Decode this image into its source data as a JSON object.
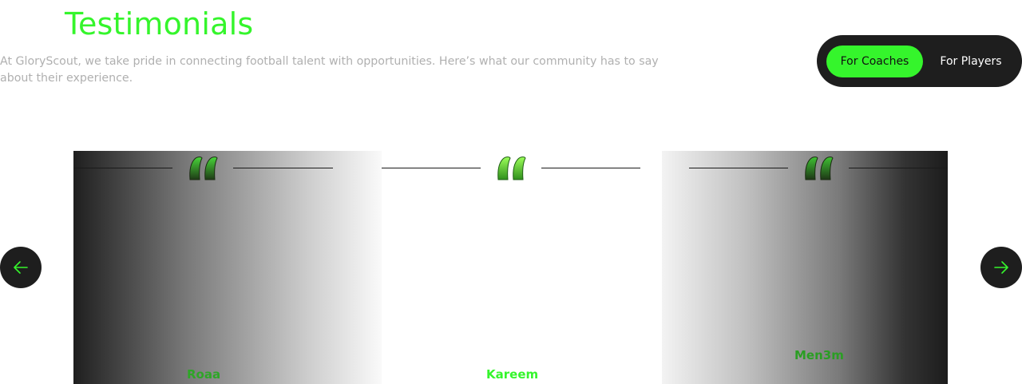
{
  "header": {
    "title": "Testimonials",
    "intro": "At GloryScout, we take pride in connecting football talent with opportunities. Here’s what our community has to say about their experience."
  },
  "audience_toggle": {
    "options": [
      "For Coaches",
      "For Players"
    ],
    "selected": "For Coaches"
  },
  "testimonials": [
    {
      "author": "Roaa"
    },
    {
      "author": "Kareem"
    },
    {
      "author": "Men3m"
    }
  ],
  "carousel": {
    "prev_icon": "arrow-left-icon",
    "next_icon": "arrow-right-icon"
  },
  "colors": {
    "accent": "#35f52c",
    "dark": "#1e1e1e",
    "muted_text": "#b0b0b0"
  }
}
